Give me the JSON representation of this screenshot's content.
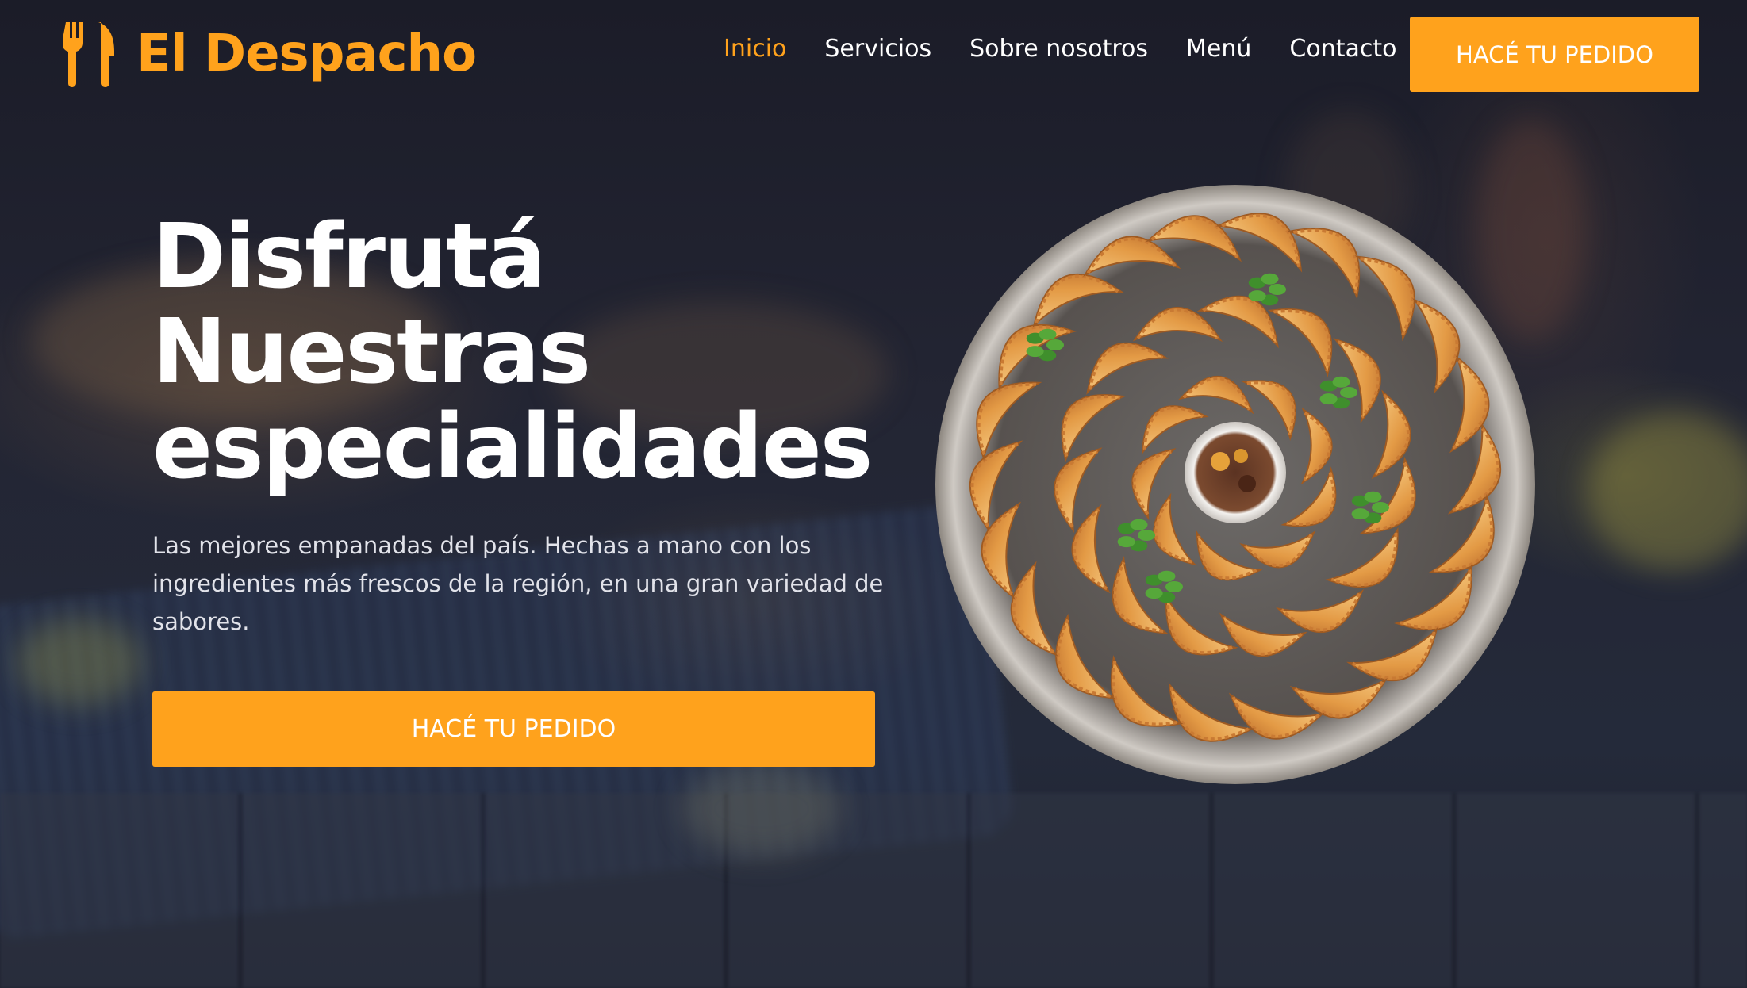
{
  "brand": {
    "name": "El Despacho",
    "icon": "fork-knife-icon",
    "accent_color": "#ffa21c"
  },
  "nav": {
    "items": [
      {
        "label": "Inicio",
        "active": true
      },
      {
        "label": "Servicios",
        "active": false
      },
      {
        "label": "Sobre nosotros",
        "active": false
      },
      {
        "label": "Menú",
        "active": false
      },
      {
        "label": "Contacto",
        "active": false
      }
    ],
    "cta_label": "HACÉ TU PEDIDO"
  },
  "hero": {
    "title_lines": [
      "Disfrutá",
      "Nuestras",
      "especialidades"
    ],
    "description": "Las mejores empanadas del país. Hechas a mano con los ingredientes más frescos de la región, en una gran variedad de sabores.",
    "cta_label": "HACÉ TU PEDIDO",
    "image": "empanadas-plate-illustration"
  }
}
